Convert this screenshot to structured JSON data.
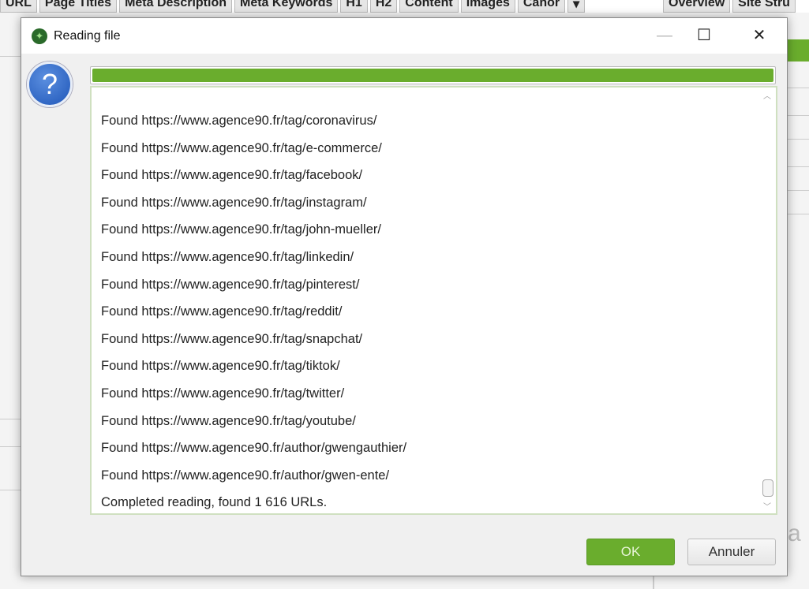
{
  "background": {
    "tabs": [
      "URL",
      "Page Titles",
      "Meta Description",
      "Meta Keywords",
      "H1",
      "H2",
      "Content",
      "Images",
      "Canor"
    ],
    "right_tabs": [
      "Overview",
      "Site Stru"
    ],
    "partial_text": "a"
  },
  "dialog": {
    "title": "Reading file",
    "progress_percent": 100,
    "colors": {
      "accent": "#6aad2d"
    },
    "log_lines": [
      "Found https://www.agence90.fr/tag/coronavirus/",
      "Found https://www.agence90.fr/tag/e-commerce/",
      "Found https://www.agence90.fr/tag/facebook/",
      "Found https://www.agence90.fr/tag/instagram/",
      "Found https://www.agence90.fr/tag/john-mueller/",
      "Found https://www.agence90.fr/tag/linkedin/",
      "Found https://www.agence90.fr/tag/pinterest/",
      "Found https://www.agence90.fr/tag/reddit/",
      "Found https://www.agence90.fr/tag/snapchat/",
      "Found https://www.agence90.fr/tag/tiktok/",
      "Found https://www.agence90.fr/tag/twitter/",
      "Found https://www.agence90.fr/tag/youtube/",
      "Found https://www.agence90.fr/author/gwengauthier/",
      "Found https://www.agence90.fr/author/gwen-ente/",
      "Completed reading, found 1 616 URLs."
    ],
    "ok_label": "OK",
    "cancel_label": "Annuler"
  }
}
